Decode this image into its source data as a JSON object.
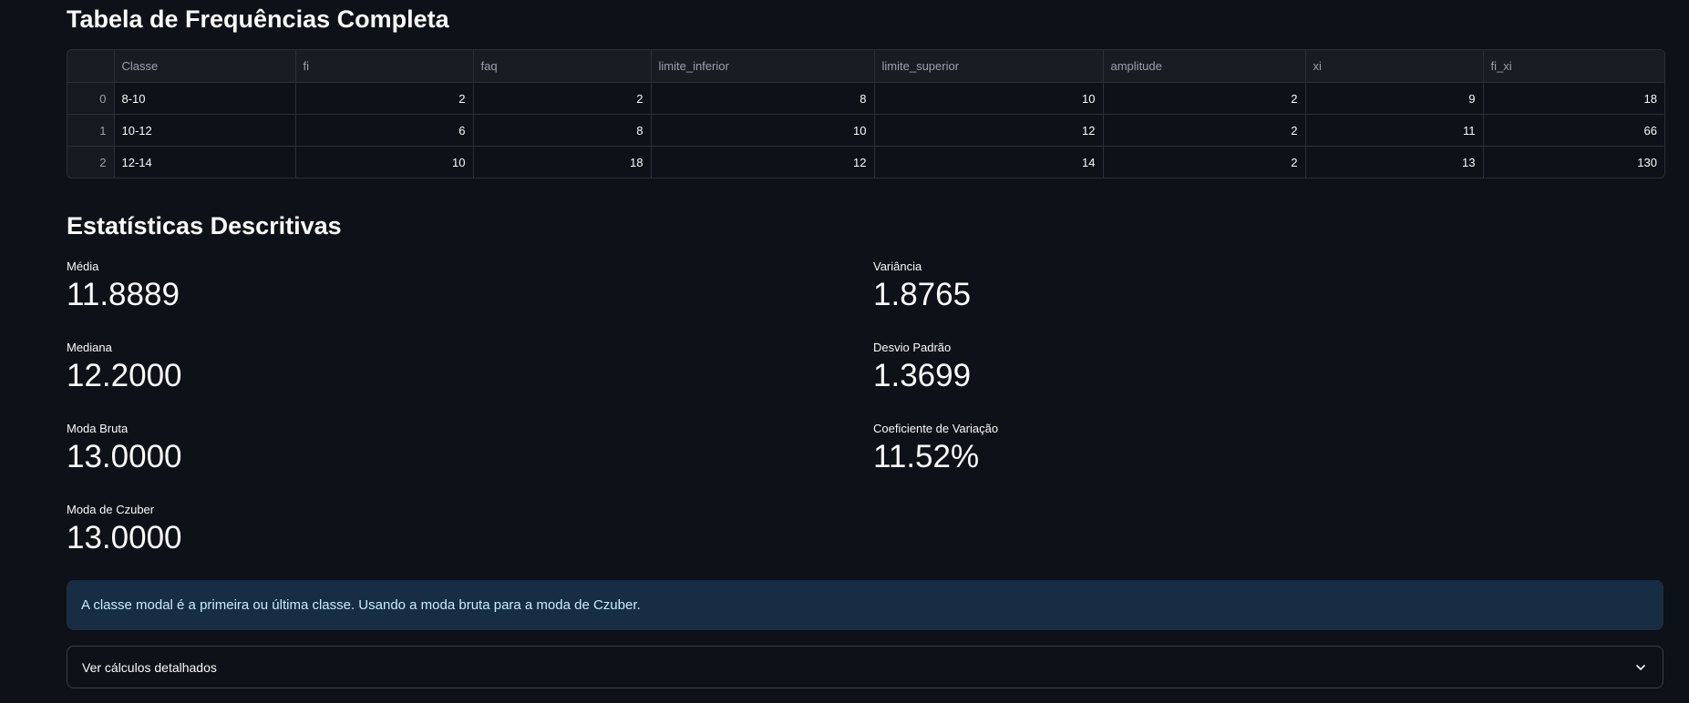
{
  "sections": {
    "freq_table_title": "Tabela de Frequências Completa",
    "stats_title": "Estatísticas Descritivas"
  },
  "table": {
    "columns": [
      "",
      "Classe",
      "fi",
      "faq",
      "limite_inferior",
      "limite_superior",
      "amplitude",
      "xi",
      "fi_xi"
    ],
    "rows": [
      [
        "0",
        "8-10",
        "2",
        "2",
        "8",
        "10",
        "2",
        "9",
        "18"
      ],
      [
        "1",
        "10-12",
        "6",
        "8",
        "10",
        "12",
        "2",
        "11",
        "66"
      ],
      [
        "2",
        "12-14",
        "10",
        "18",
        "12",
        "14",
        "2",
        "13",
        "130"
      ]
    ]
  },
  "metrics": {
    "media": {
      "label": "Média",
      "value": "11.8889"
    },
    "mediana": {
      "label": "Mediana",
      "value": "12.2000"
    },
    "moda_bruta": {
      "label": "Moda Bruta",
      "value": "13.0000"
    },
    "moda_czuber": {
      "label": "Moda de Czuber",
      "value": "13.0000"
    },
    "variancia": {
      "label": "Variância",
      "value": "1.8765"
    },
    "desvio": {
      "label": "Desvio Padrão",
      "value": "1.3699"
    },
    "cv": {
      "label": "Coeficiente de Variação",
      "value": "11.52%"
    }
  },
  "info": {
    "text": "A classe modal é a primeira ou última classe. Usando a moda bruta para a moda de Czuber."
  },
  "expander": {
    "label": "Ver cálculos detalhados",
    "icon": "chevron-down-icon"
  },
  "colors": {
    "background": "#0e1117",
    "info_bg": "#172d43",
    "info_text": "#c7ebff"
  }
}
